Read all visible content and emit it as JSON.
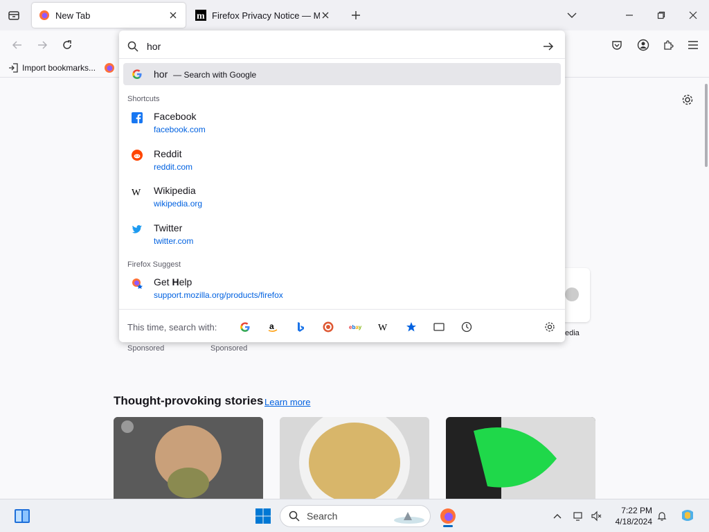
{
  "tabs": [
    {
      "title": "New Tab",
      "active": true
    },
    {
      "title": "Firefox Privacy Notice — Mozilla",
      "active": false
    }
  ],
  "bookmarks": {
    "import_label": "Import bookmarks..."
  },
  "urlbar": {
    "value": "hor"
  },
  "search_row": {
    "query": "hor",
    "suffix": "— Search with Google"
  },
  "shortcuts_heading": "Shortcuts",
  "shortcuts": [
    {
      "title": "Facebook",
      "url": "facebook.com"
    },
    {
      "title": "Reddit",
      "url": "reddit.com"
    },
    {
      "title": "Wikipedia",
      "url": "wikipedia.org"
    },
    {
      "title": "Twitter",
      "url": "twitter.com"
    }
  ],
  "suggest_heading": "Firefox Suggest",
  "suggest": {
    "title_pre": "Get ",
    "title_bold": "H",
    "title_post": "elp",
    "url": "support.mozilla.org/products/firefox"
  },
  "search_with_label": "This time, search with:",
  "page": {
    "sponsored_1": "Sponsored",
    "sponsored_2": "Sponsored",
    "wiki_tile_label": "edia",
    "stories_heading": "Thought-provoking stories",
    "learn_more": "Learn more"
  },
  "taskbar": {
    "search_placeholder": "Search",
    "time": "7:22 PM",
    "date": "4/18/2024"
  },
  "colors": {
    "accent": "#0061e0",
    "firefox_orange": "#ff7139"
  }
}
